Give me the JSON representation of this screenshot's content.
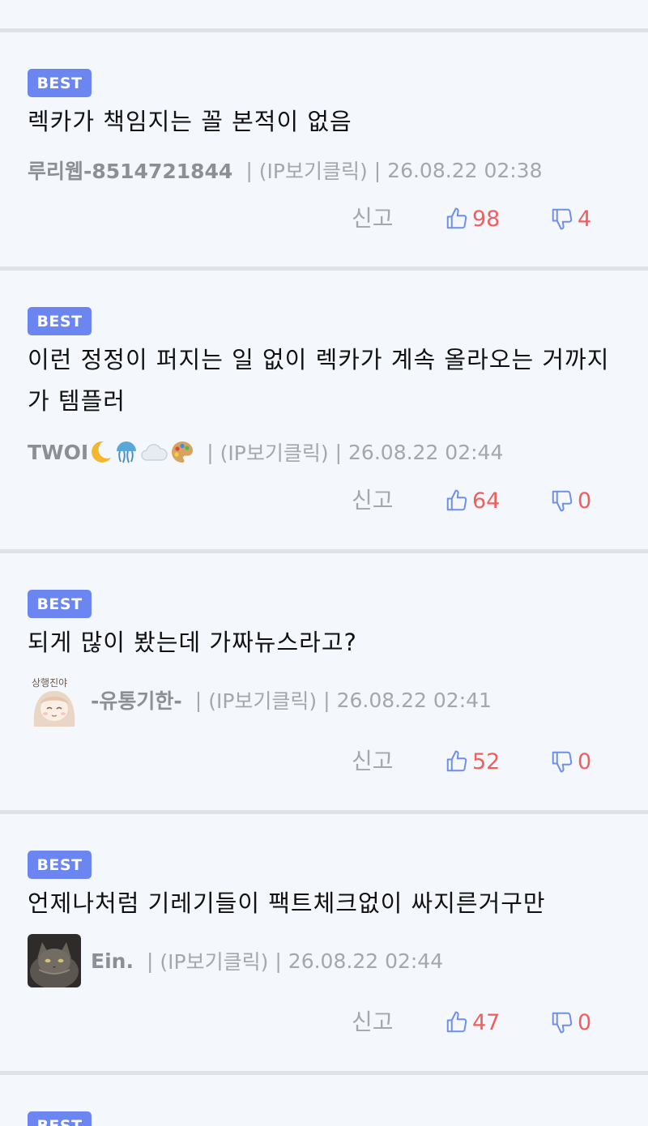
{
  "comments": [
    {
      "badge": "BEST",
      "text": "렉카가 책임지는 꼴 본적이 없음",
      "author": "루리웹-8514721844",
      "ip": "(IP보기클릭)",
      "time": "26.08.22 02:38",
      "report": "신고",
      "up": "98",
      "down": "4"
    },
    {
      "badge": "BEST",
      "text": "이런 정정이 퍼지는 일 없이 렉카가 계속 올라오는 거까지가 템플러",
      "author": "TWOI",
      "author_emojis": [
        "moon-icon",
        "jellyfish-icon",
        "cloud-icon",
        "palette-icon"
      ],
      "ip": "(IP보기클릭)",
      "time": "26.08.22 02:44",
      "report": "신고",
      "up": "64",
      "down": "0"
    },
    {
      "badge": "BEST",
      "text": "되게 많이 봤는데 가짜뉴스라고?",
      "avatar": "anime-character-avatar",
      "author": "-유통기한-",
      "ip": "(IP보기클릭)",
      "time": "26.08.22 02:41",
      "report": "신고",
      "up": "52",
      "down": "0"
    },
    {
      "badge": "BEST",
      "text": "언제나처럼 기레기들이 팩트체크없이 싸지른거구만",
      "avatar": "cat-photo-avatar",
      "author": "Ein.",
      "ip": "(IP보기클릭)",
      "time": "26.08.22 02:44",
      "report": "신고",
      "up": "47",
      "down": "0"
    },
    {
      "badge": "BEST"
    }
  ],
  "colors": {
    "badge_bg": "#6b86f0",
    "card_bg": "#f4f7fb",
    "divider": "#dfe3e9",
    "like_count": "#ef5f5f",
    "thumb_icon": "#6f8fe8",
    "meta_text": "#a3a8ae"
  }
}
